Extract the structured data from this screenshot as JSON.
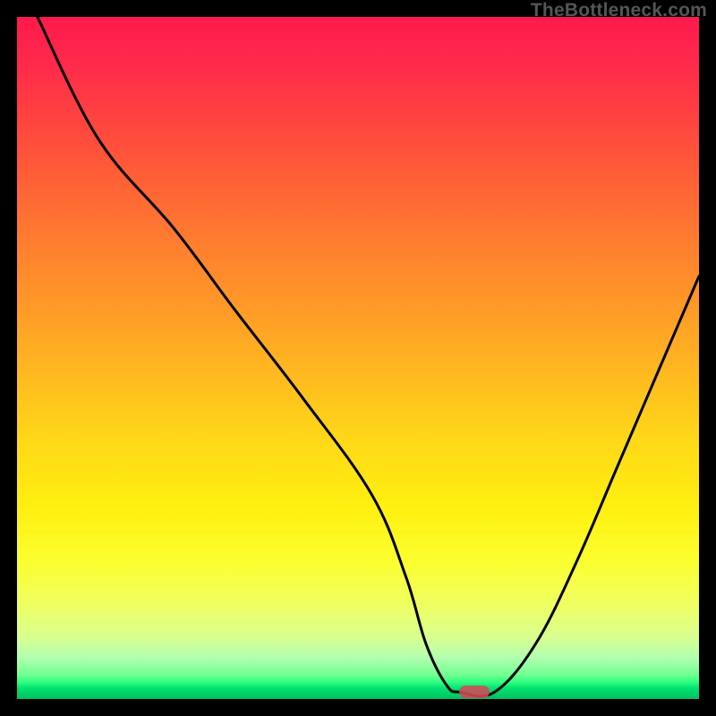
{
  "watermark": "TheBottleneck.com",
  "chart_data": {
    "type": "line",
    "title": "",
    "xlabel": "",
    "ylabel": "",
    "xlim": [
      0,
      100
    ],
    "ylim": [
      0,
      100
    ],
    "grid": false,
    "series": [
      {
        "name": "bottleneck-curve",
        "x": [
          3,
          12,
          23,
          32,
          42,
          52,
          57,
          60,
          63,
          65,
          70,
          76,
          82,
          88,
          94,
          100
        ],
        "values": [
          100,
          82,
          69,
          57,
          44,
          30,
          18,
          8,
          2,
          1,
          1,
          8,
          20,
          34,
          48,
          62
        ]
      }
    ],
    "annotations": [
      {
        "name": "optimal-marker",
        "x": 67,
        "y": 1,
        "shape": "pill",
        "color": "#d04a58"
      }
    ],
    "background_gradient": {
      "top": "#ff1a4d",
      "mid": "#ffd818",
      "bottom": "#00c060"
    }
  }
}
